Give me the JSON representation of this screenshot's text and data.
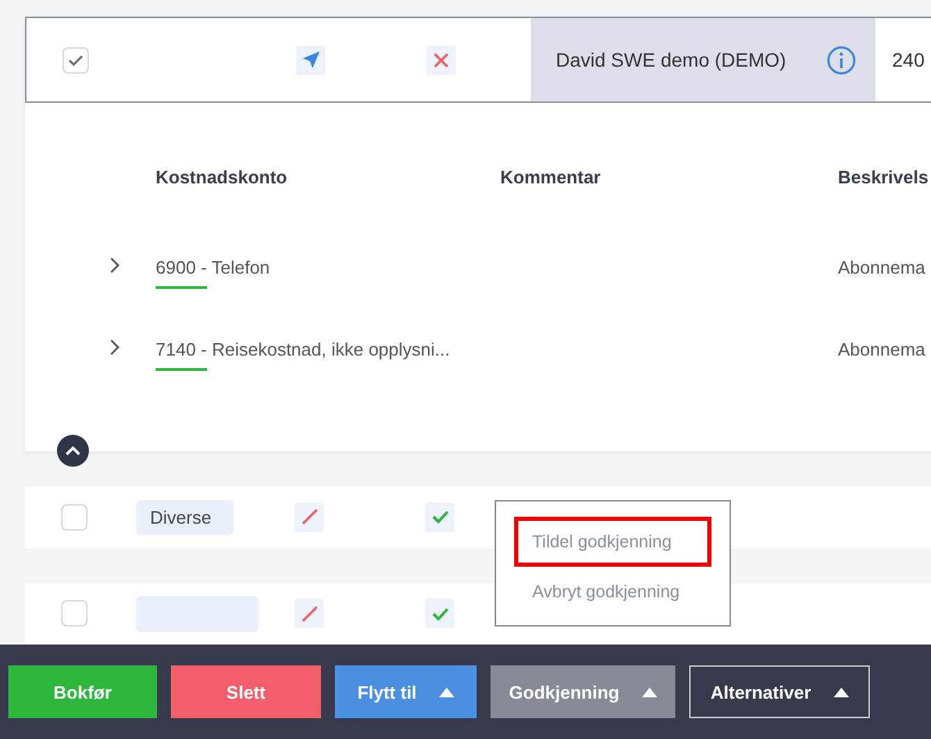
{
  "expanded_entry": {
    "checked": true,
    "supplier": "David SWE demo (DEMO)",
    "amount": "240",
    "lines_header": [
      "Kostnadskonto",
      "Kommentar",
      "Beskrivels"
    ],
    "lines": [
      {
        "account": "6900 - Telefon",
        "description": "Abonnema"
      },
      {
        "account": "7140 - Reisekostnad, ikke opplysni...",
        "description": "Abonnema"
      }
    ]
  },
  "entries": [
    {
      "checked": false,
      "tag": "Diverse",
      "approved": true
    },
    {
      "checked": false,
      "approved": true
    }
  ],
  "approval_menu": [
    {
      "label": "Tildel godkjenning",
      "highlighted": true
    },
    {
      "label": "Avbryt godkjenning",
      "highlighted": false
    }
  ],
  "actions": [
    {
      "label": "Bokfør",
      "kind": "post",
      "dropdown": false
    },
    {
      "label": "Slett",
      "kind": "delete",
      "dropdown": false
    },
    {
      "label": "Flytt til",
      "kind": "move",
      "dropdown": true
    },
    {
      "label": "Godkjenning",
      "kind": "approval",
      "dropdown": true
    },
    {
      "label": "Alternativer",
      "kind": "options",
      "dropdown": true
    }
  ]
}
